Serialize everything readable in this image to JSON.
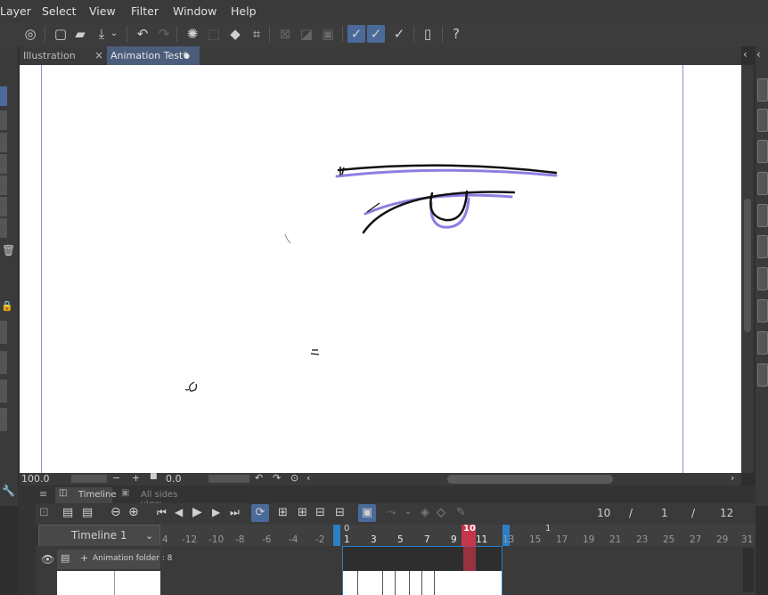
{
  "menu": [
    "Layer",
    "Select",
    "View",
    "Filter",
    "Window",
    "Help"
  ],
  "tabs": [
    {
      "label": "Illustration",
      "close": "×"
    },
    {
      "label": "Animation Test*",
      "close": "●"
    }
  ],
  "statusbar": {
    "zoom": "100.0",
    "angle": "0.0"
  },
  "timeline": {
    "tab_label": "Timeline",
    "tab2_label": "All sides view",
    "name": "Timeline 1",
    "current_frame": "10",
    "start_frame": "1",
    "end_frame": "12",
    "slash1": "/",
    "slash2": "/",
    "track_name": "Animation folder : 8",
    "ruler_top": [
      "0",
      "10",
      "1"
    ],
    "ruler_labels": [
      "4",
      "-12",
      "-10",
      "-8",
      "-6",
      "-4",
      "-2",
      "1",
      "3",
      "5",
      "7",
      "9",
      "11",
      "13",
      "15",
      "17",
      "19",
      "21",
      "23",
      "25",
      "27",
      "29",
      "31"
    ],
    "ruler_playhead": "10"
  },
  "colors": {
    "accent": "#2b7fc4",
    "playhead": "#c4364a",
    "guide": "#8b7fe0"
  }
}
